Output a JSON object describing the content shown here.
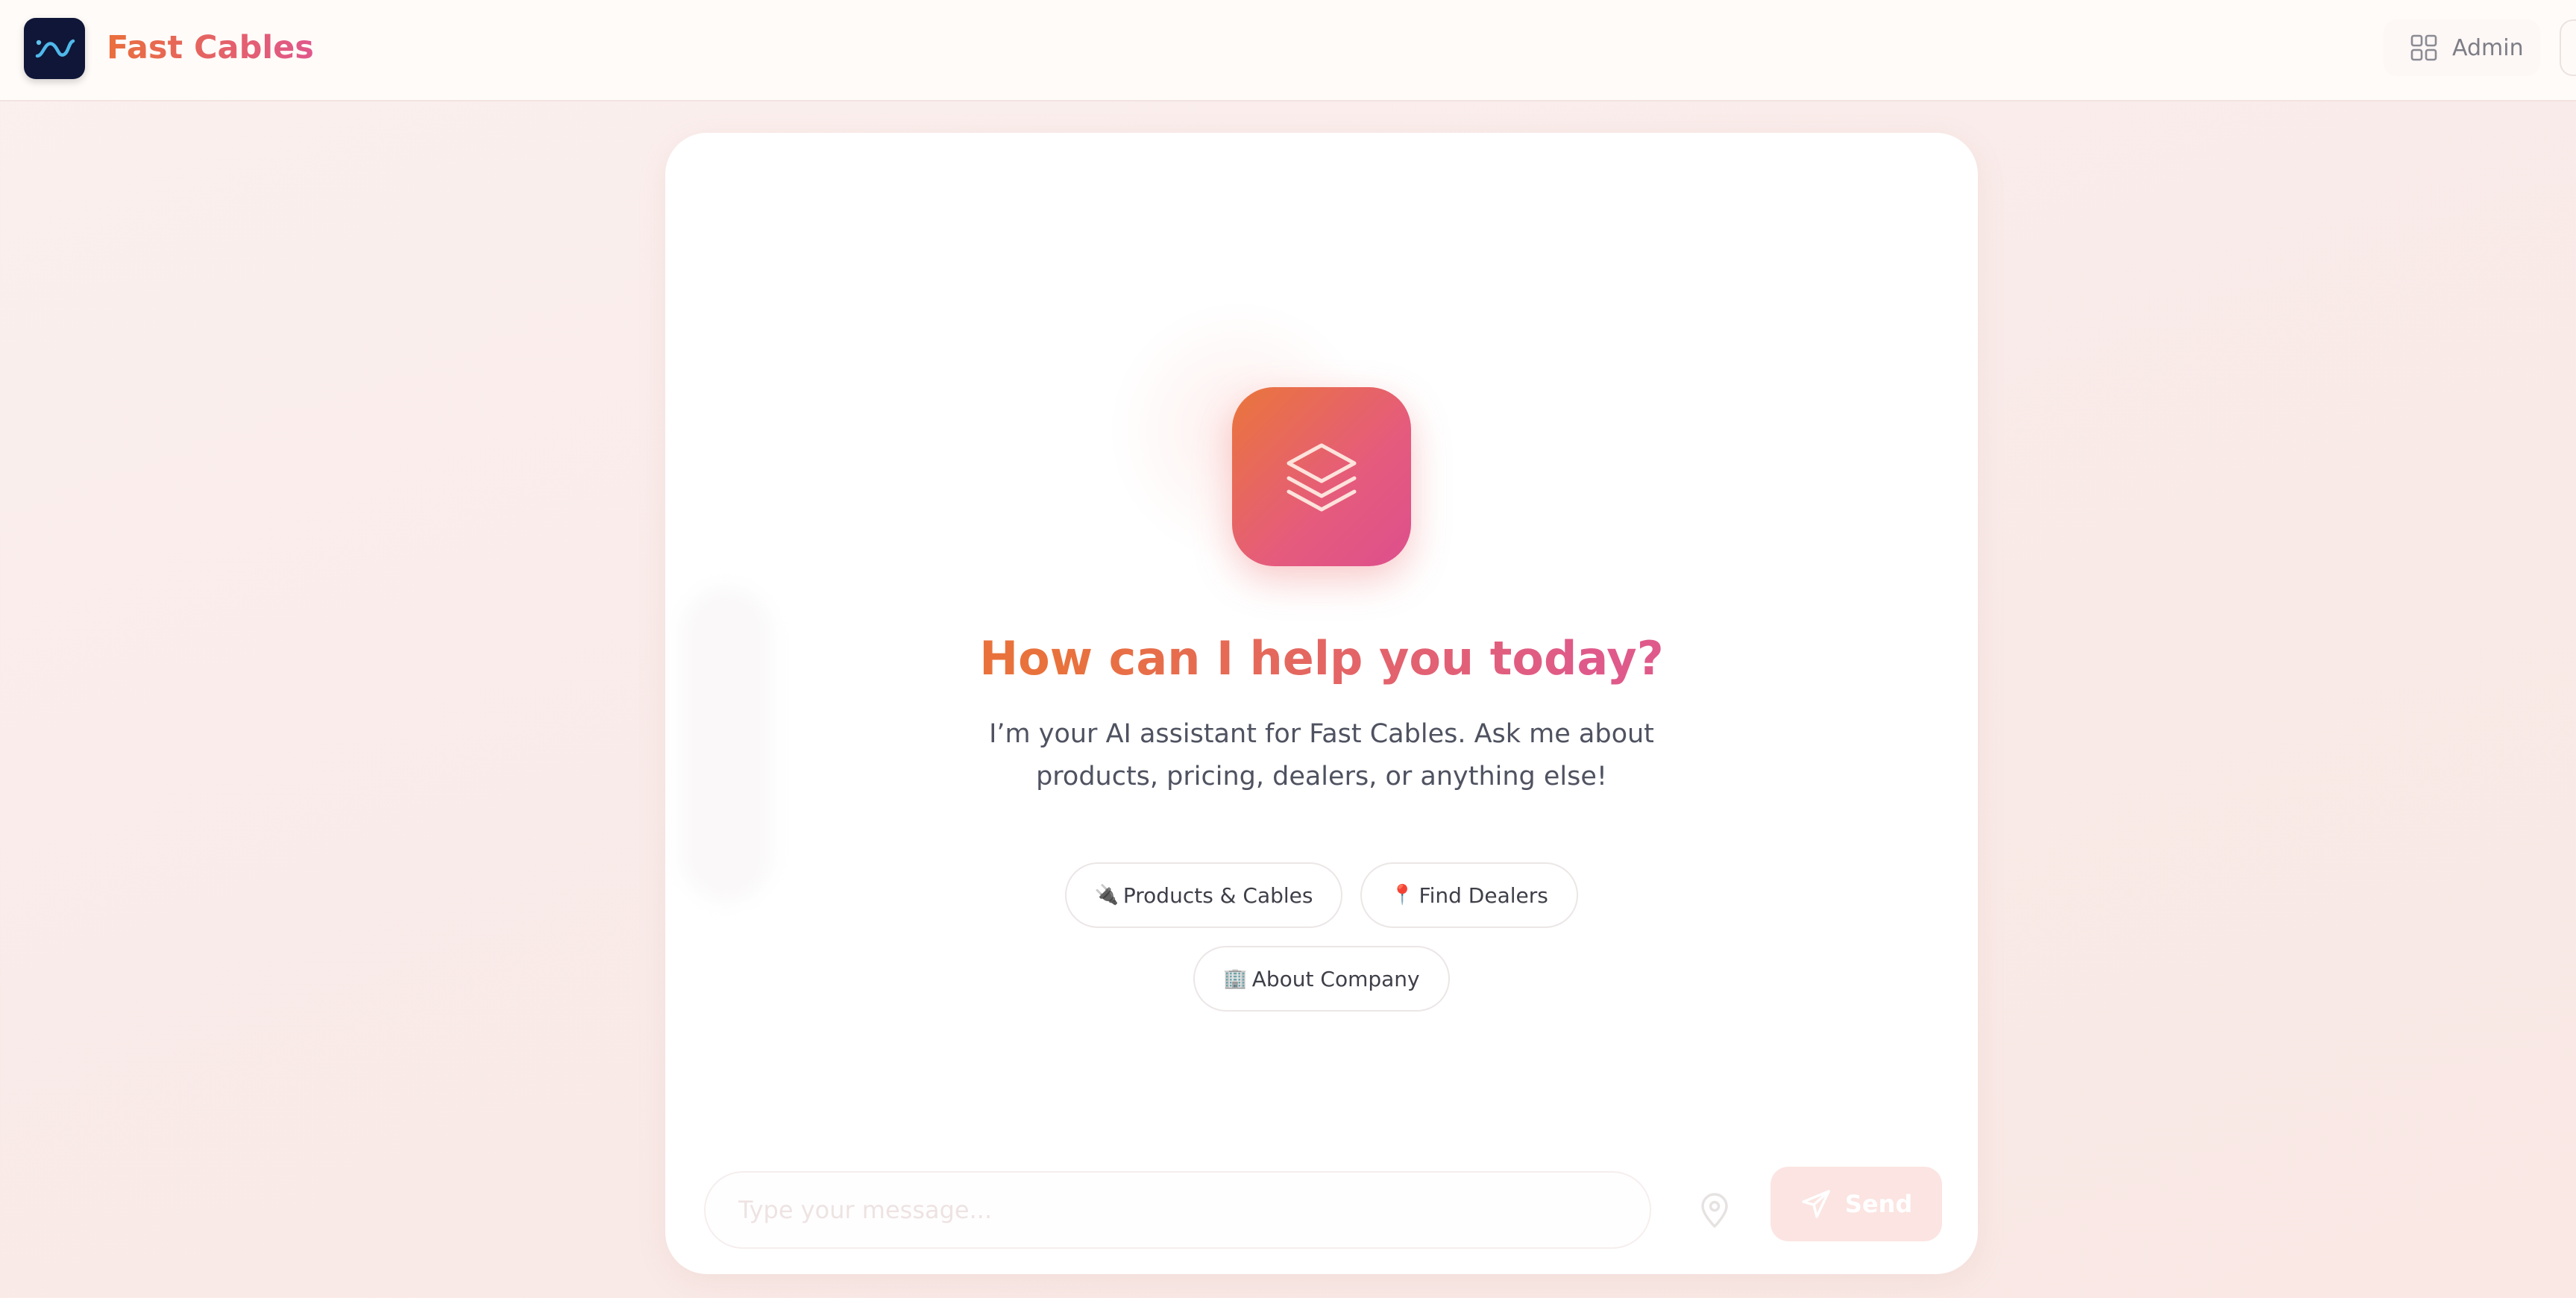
{
  "header": {
    "brand": "Fast Cables",
    "admin_label": "Admin"
  },
  "hero": {
    "title": "How can I help you today?",
    "subtitle_line1": "I’m your AI assistant for Fast Cables. Ask me about",
    "subtitle_line2": "products, pricing, dealers, or anything else!"
  },
  "suggestions": [
    {
      "emoji": "🔌",
      "label": "Products & Cables"
    },
    {
      "emoji": "📍",
      "label": "Find Dealers"
    },
    {
      "emoji": "🏢",
      "label": "About Company"
    }
  ],
  "composer": {
    "placeholder": "Type your message...",
    "send_label": "Send"
  },
  "icons": {
    "logo": "wave-logo-icon",
    "admin": "grid-icon",
    "hero": "layers-icon",
    "location": "map-pin-icon",
    "send": "send-icon"
  },
  "colors": {
    "accent_orange": "#ea763a",
    "accent_pink": "#dd4f8d",
    "logo_bg": "#0f1638"
  }
}
